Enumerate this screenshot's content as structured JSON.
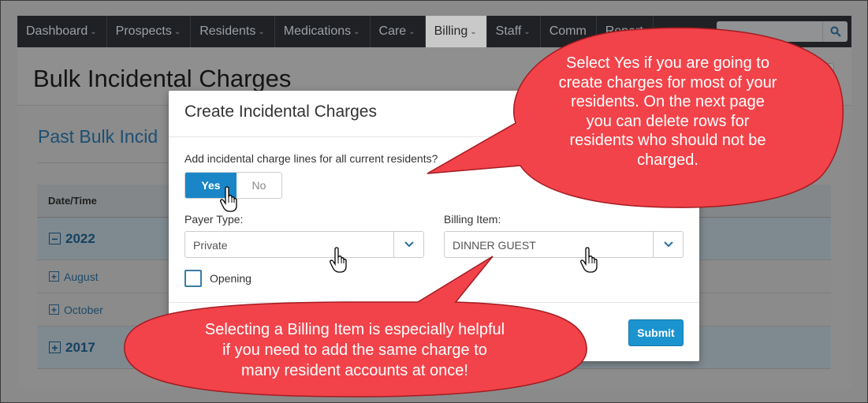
{
  "nav": {
    "items": [
      {
        "label": "Dashboard"
      },
      {
        "label": "Prospects"
      },
      {
        "label": "Residents"
      },
      {
        "label": "Medications"
      },
      {
        "label": "Care"
      },
      {
        "label": "Billing",
        "active": true
      },
      {
        "label": "Staff"
      },
      {
        "label": "Comm"
      },
      {
        "label": "Report"
      }
    ]
  },
  "page": {
    "title": "Bulk Incidental Charges",
    "section_title": "Past Bulk Incid",
    "table": {
      "header": "Date/Time",
      "rows": [
        {
          "kind": "year",
          "icon": "minus-box-icon",
          "label": "2022"
        },
        {
          "kind": "month",
          "icon": "plus-box-icon",
          "label": "August"
        },
        {
          "kind": "month",
          "icon": "plus-box-icon",
          "label": "October"
        },
        {
          "kind": "year",
          "icon": "plus-box-icon",
          "label": "2017"
        }
      ]
    }
  },
  "modal": {
    "title": "Create Incidental Charges",
    "question": "Add incidental charge lines for all current residents?",
    "yes_label": "Yes",
    "no_label": "No",
    "payer_type_label": "Payer Type:",
    "payer_type_value": "Private",
    "billing_item_label": "Billing Item:",
    "billing_item_value": "DINNER GUEST",
    "opening_label": "Opening",
    "submit_label": "Submit"
  },
  "callouts": {
    "top": [
      "Select Yes if you are going to",
      "create charges for most of your",
      "residents. On the next page",
      "you can delete rows for",
      "residents who should not be",
      "charged."
    ],
    "bottom": [
      "Selecting a Billing Item is especially helpful",
      "if you need to add the same charge to",
      "many resident accounts at once!"
    ],
    "fill_color": "#f2434a",
    "stroke_color": "#a51c22"
  },
  "colors": {
    "primary_button": "#1b86c7",
    "nav_bg": "#1f2124",
    "link": "#1c4f73"
  }
}
